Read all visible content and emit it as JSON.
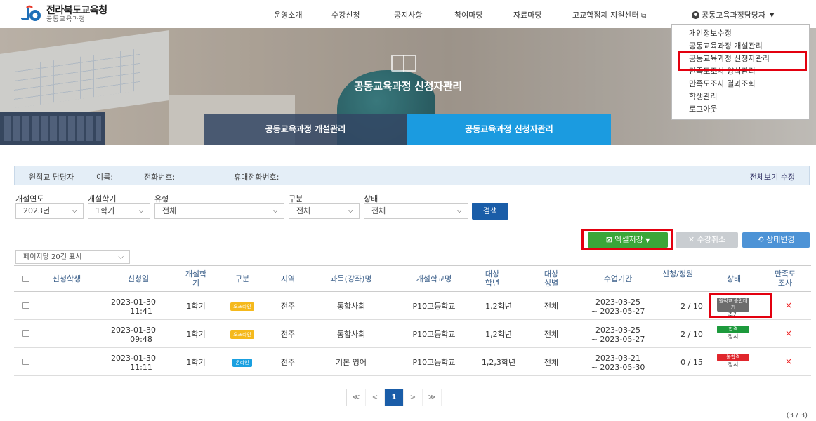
{
  "brand": {
    "title": "전라북도교육청",
    "subtitle": "공동교육과정"
  },
  "nav": [
    "운영소개",
    "수강신청",
    "공지사항",
    "참여마당",
    "자료마당",
    "고교학점제 지원센터"
  ],
  "user_menu": {
    "label": "공동교육과정담당자"
  },
  "dropdown": [
    "개인정보수정",
    "공동교육과정 개설관리",
    "공동교육과정 신청자관리",
    "만족도조사 양식관리",
    "만족도조사 결과조회",
    "학생관리",
    "로그아웃"
  ],
  "hero": {
    "title": "공동교육과정 신청자관리",
    "tabs": [
      "공동교육과정 개설관리",
      "공동교육과정 신청자관리"
    ]
  },
  "info_bar": {
    "contact": "원적교 담당자",
    "name_label": "이름:",
    "phone_label": "전화번호:",
    "mobile_label": "휴대전화번호:",
    "links": "전체보기 수정"
  },
  "filters": {
    "labels": [
      "개설연도",
      "개설학기",
      "유형",
      "구분",
      "상태"
    ],
    "values": [
      "2023년",
      "1학기",
      "전체",
      "전체",
      "전체"
    ],
    "search_label": "검색"
  },
  "actions": {
    "excel": "엑셀저장",
    "cancel": "수강취소",
    "status": "상태변경"
  },
  "per_page": "페이지당 20건 표시",
  "table": {
    "headers": [
      "신청학생",
      "신청일",
      "개설학기",
      "구분",
      "지역",
      "과목(강좌)명",
      "개설학교명",
      "대상학년",
      "대상성별",
      "수업기간",
      "신청/정원",
      "상태",
      "만족도조사"
    ],
    "rows": [
      {
        "date": "2023-01-30",
        "time": "11:41",
        "semester": "1학기",
        "type": "오프라인",
        "type_kind": "off",
        "region": "전주",
        "subject": "통합사회",
        "school": "P10고등학교",
        "grade": "1,2학년",
        "gender": "전체",
        "period_start": "2023-03-25",
        "period_end": "~ 2023-05-27",
        "quota": "2 / 10",
        "status": "원적교 승인대기",
        "status_sub": "추가",
        "status_color": "#6c6c6c",
        "survey": "×"
      },
      {
        "date": "2023-01-30",
        "time": "09:48",
        "semester": "1학기",
        "type": "오프라인",
        "type_kind": "off",
        "region": "전주",
        "subject": "통합사회",
        "school": "P10고등학교",
        "grade": "1,2학년",
        "gender": "전체",
        "period_start": "2023-03-25",
        "period_end": "~ 2023-05-27",
        "quota": "2 / 10",
        "status": "합격",
        "status_sub": "정시",
        "status_color": "#1d9a3c",
        "survey": "×"
      },
      {
        "date": "2023-01-30",
        "time": "11:11",
        "semester": "1학기",
        "type": "온라인",
        "type_kind": "on",
        "region": "전주",
        "subject": "기본 영어",
        "school": "P10고등학교",
        "grade": "1,2,3학년",
        "gender": "전체",
        "period_start": "2023-03-21",
        "period_end": "~ 2023-05-30",
        "quota": "0 / 15",
        "status": "불합격",
        "status_sub": "정시",
        "status_color": "#e0262c",
        "survey": "×"
      }
    ]
  },
  "pagination": {
    "first": "≪",
    "prev": "<",
    "current": "1",
    "next": ">",
    "last": "≫"
  },
  "count": "(3 / 3)",
  "colors": {
    "primary": "#1a5da8",
    "tab_active": "#1b9be0",
    "excel": "#3aa639",
    "highlight": "#e3000f"
  }
}
